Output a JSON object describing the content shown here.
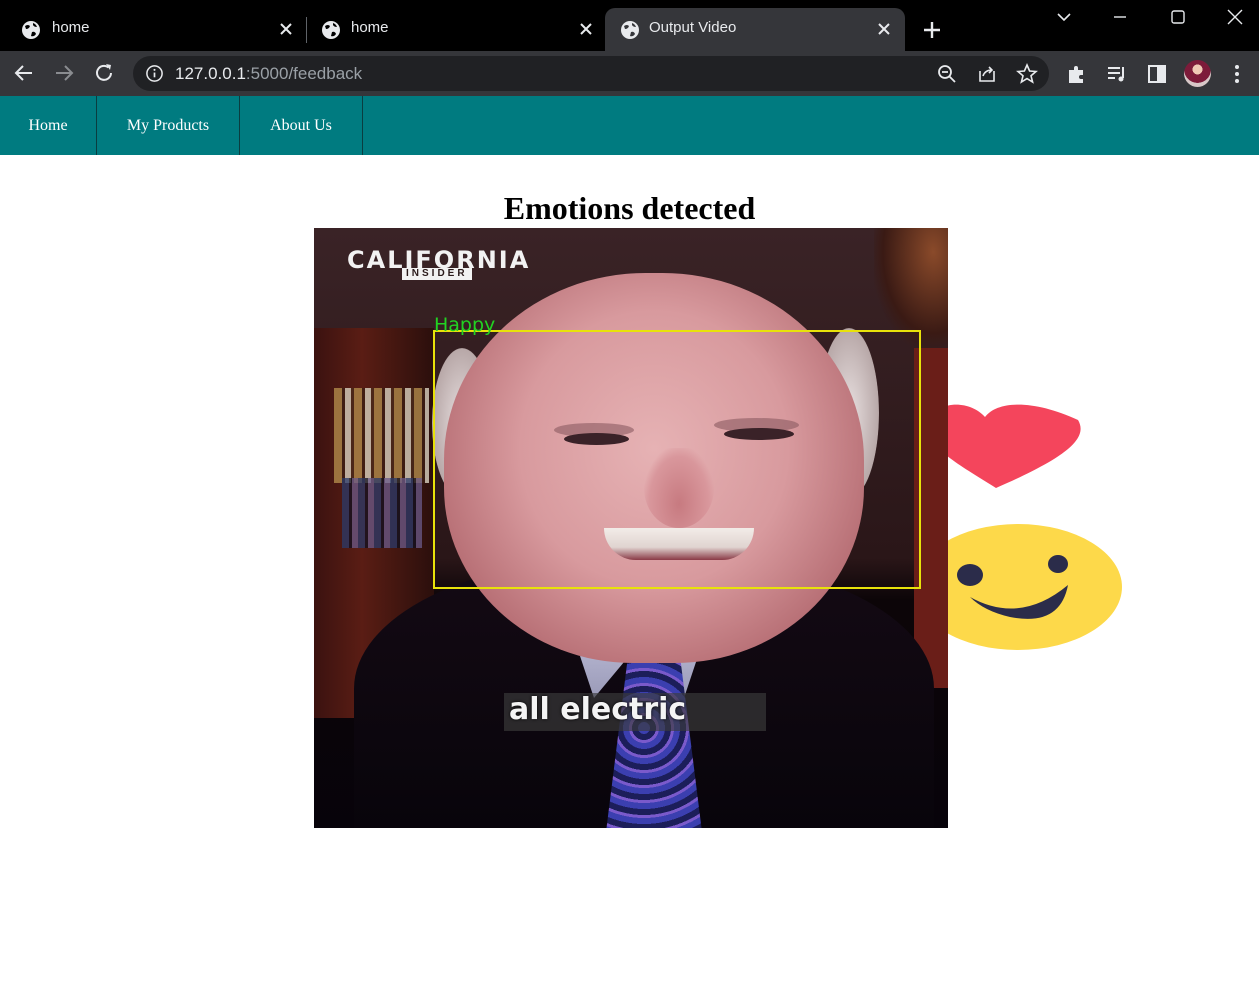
{
  "browser": {
    "tabs": [
      {
        "title": "home",
        "icon": "globe-icon",
        "active": false
      },
      {
        "title": "home",
        "icon": "globe-icon",
        "active": false
      },
      {
        "title": "Output Video",
        "icon": "globe-icon",
        "active": true
      }
    ],
    "address": {
      "host": "127.0.0.1",
      "path": ":5000/feedback"
    },
    "colors": {
      "tabstrip": "#000000",
      "toolbar": "#35363a",
      "omnibox": "#202124"
    }
  },
  "nav": {
    "items": [
      {
        "label": "Home"
      },
      {
        "label": "My Products"
      },
      {
        "label": "About Us"
      }
    ],
    "color": "#007b80"
  },
  "main": {
    "title": "Emotions detected",
    "video": {
      "channel_logo": "CALIFORNIA",
      "channel_logo_sub": "INSIDER",
      "detected_emotion": "Happy",
      "caption": "all electric",
      "box_color": "#e8e20a",
      "label_color": "#22d222"
    },
    "decoration": {
      "icons": [
        "heart-icon",
        "smiley-face-icon"
      ],
      "heart_color": "#f4455c",
      "smiley_color": "#fdd94a"
    }
  }
}
